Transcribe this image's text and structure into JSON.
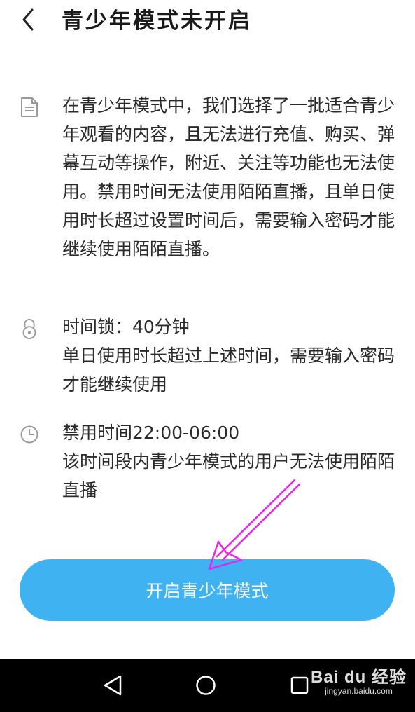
{
  "header": {
    "title": "青少年模式未开启",
    "back_icon": "chevron-left-icon"
  },
  "items": [
    {
      "icon": "document-icon",
      "text": "在青少年模式中，我们选择了一批适合青少年观看的内容，且无法进行充值、购买、弹幕互动等操作，附近、关注等功能也无法使用。禁用时间无法使用陌陌直播，且单日使用时长超过设置时间后，需要输入密码才能继续使用陌陌直播。"
    },
    {
      "icon": "lock-icon",
      "title": "时间锁：40分钟",
      "text": "单日使用时长超过上述时间，需要输入密码才能继续使用"
    },
    {
      "icon": "clock-icon",
      "title": "禁用时间22:00-06:00",
      "text": "该时间段内青少年模式的用户无法使用陌陌直播"
    }
  ],
  "button": {
    "label": "开启青少年模式",
    "color": "#3fb2f2"
  },
  "annotation": {
    "arrow_color": "#ee22ee"
  },
  "navbar": {
    "buttons": [
      "back-triangle-icon",
      "home-circle-icon",
      "recents-square-icon"
    ]
  },
  "watermark": {
    "logo": "Bai du 经验",
    "url": "jingyan.baidu.com"
  }
}
